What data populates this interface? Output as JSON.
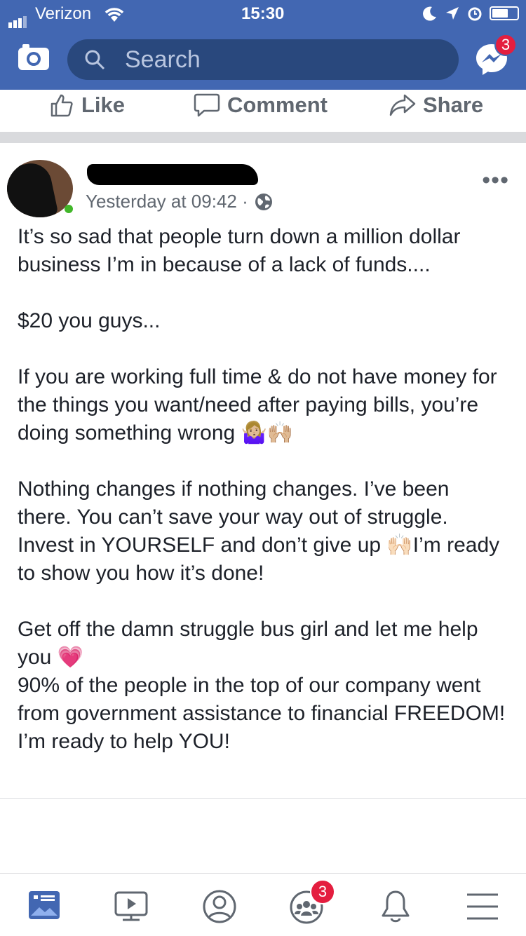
{
  "status_bar": {
    "carrier": "Verizon",
    "time": "15:30"
  },
  "top_bar": {
    "search_placeholder": "Search",
    "messenger_badge": "3"
  },
  "post_actions": {
    "like": "Like",
    "comment": "Comment",
    "share": "Share"
  },
  "post": {
    "timestamp": "Yesterday at 09:42 ·",
    "paragraphs": [
      "It’s so sad that people turn down a million dollar business I’m in because of a lack of funds....",
      "$20 you guys...",
      "If you are working full time & do not have money for the things you want/need after paying bills, you’re doing something wrong 🤷🏼‍♀️🙌🏼",
      "Nothing changes if nothing changes. I’ve been there. You can’t save your way out of struggle. Invest in YOURSELF and don’t give up 🙌🏻I’m ready to show you how it’s done!",
      "Get off the damn struggle bus girl and let me help you 💗",
      "90% of the people in the top of our company went from government assistance to financial FREEDOM! I’m ready to help YOU!"
    ]
  },
  "bottom_nav": {
    "groups_badge": "3"
  },
  "colors": {
    "brand_blue": "#4267b2",
    "search_bg": "#29487d",
    "badge_red": "#e41e3f",
    "text_dark": "#1d2129",
    "text_gray": "#606770"
  }
}
